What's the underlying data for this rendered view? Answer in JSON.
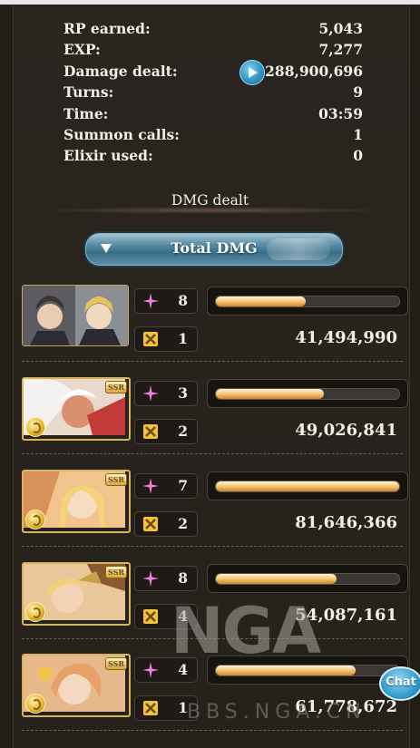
{
  "stats": [
    {
      "label": "RP earned:",
      "value": "5,043"
    },
    {
      "label": "EXP:",
      "value": "7,277"
    },
    {
      "label": "Damage dealt:",
      "value": "288,900,696"
    },
    {
      "label": "Turns:",
      "value": "9"
    },
    {
      "label": "Time:",
      "value": "03:59"
    },
    {
      "label": "Summon calls:",
      "value": "1"
    },
    {
      "label": "Elixir used:",
      "value": "0"
    }
  ],
  "section_title": "DMG dealt",
  "total_button": {
    "label": "Total DMG"
  },
  "characters": [
    {
      "icon": "portrait-pair-icon",
      "skills": "8",
      "chain": "1",
      "gauge": 0.49,
      "damage": "41,494,990"
    },
    {
      "icon": "portrait-icon",
      "badge": "SSR",
      "skills": "3",
      "chain": "2",
      "gauge": 0.59,
      "damage": "49,026,841"
    },
    {
      "icon": "portrait-icon",
      "badge": "SSR",
      "skills": "7",
      "chain": "2",
      "gauge": 1.0,
      "damage": "81,646,366"
    },
    {
      "icon": "portrait-icon",
      "badge": "SSR",
      "skills": "8",
      "chain": "4",
      "gauge": 0.66,
      "damage": "54,087,161"
    },
    {
      "icon": "portrait-icon",
      "badge": "SSR",
      "skills": "4",
      "chain": "1",
      "gauge": 0.76,
      "damage": "61,778,672"
    }
  ],
  "watermark": {
    "logo": "NGA",
    "sub": "BBS.NGA.CN"
  },
  "chat": {
    "label": "Chat"
  },
  "colors": {
    "gauge_fill": "#f2c06a",
    "skill_icon": "#f07fe0",
    "chain_icon": "#f3c23c",
    "button_blue": "#3a6d86"
  }
}
